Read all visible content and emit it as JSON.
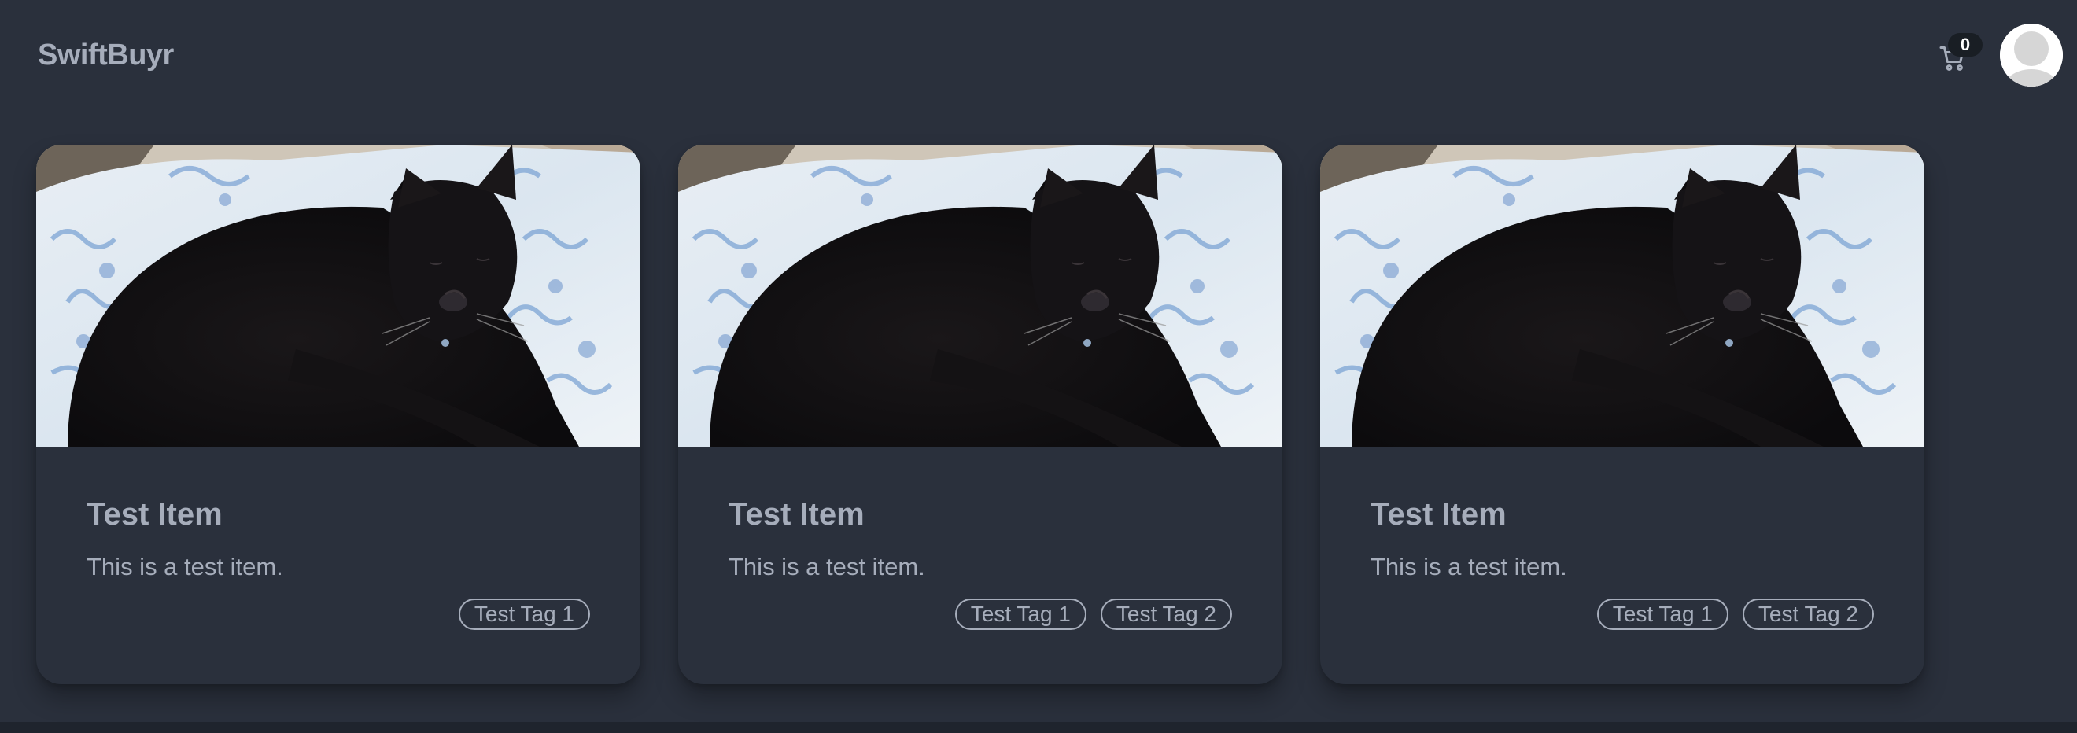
{
  "navbar": {
    "brand": "SwiftBuyr",
    "cart_count": "0",
    "cart_icon": "shopping-cart-icon",
    "avatar_icon": "user-avatar-icon"
  },
  "items": [
    {
      "title": "Test Item",
      "description": "This is a test item.",
      "tags": [
        "Test Tag 1"
      ]
    },
    {
      "title": "Test Item",
      "description": "This is a test item.",
      "tags": [
        "Test Tag 1",
        "Test Tag 2"
      ]
    },
    {
      "title": "Test Item",
      "description": "This is a test item.",
      "tags": [
        "Test Tag 1",
        "Test Tag 2"
      ]
    }
  ],
  "colors": {
    "background": "#2a303c",
    "text": "#a6adbb",
    "badge": "#191e24"
  }
}
